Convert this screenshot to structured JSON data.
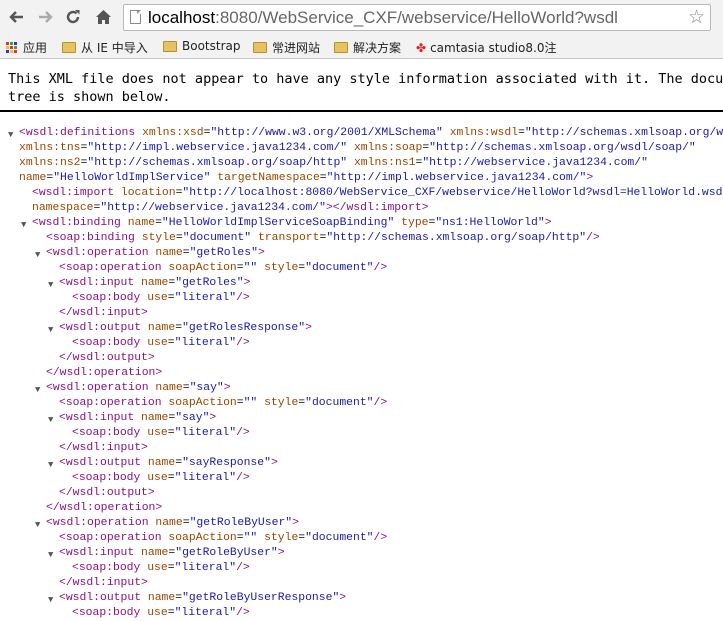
{
  "browser": {
    "url_host": "localhost",
    "url_rest": ":8080/WebService_CXF/webservice/HelloWorld?wsdl"
  },
  "bookmarks": [
    {
      "label": "应用",
      "icon": "apps-grid-icon"
    },
    {
      "label": "从 IE 中导入",
      "icon": "folder-icon"
    },
    {
      "label": "Bootstrap",
      "icon": "folder-icon"
    },
    {
      "label": "常进网站",
      "icon": "folder-icon"
    },
    {
      "label": "解决方案",
      "icon": "folder-icon"
    },
    {
      "label": "camtasia studio8.0注",
      "icon": "camtasia-icon"
    }
  ],
  "notice": {
    "line1": "This XML file does not appear to have any style information associated with it. The document",
    "line2": "tree is shown below."
  },
  "xml_lines": [
    {
      "collapse": true,
      "indent": 0,
      "tag": "<wsdl:definitions",
      "attrs": [
        [
          "xmlns:xsd",
          "http://www.w3.org/2001/XMLSchema"
        ],
        [
          "xmlns:wsdl",
          "http://schemas.xmlsoap.org/wsdl/"
        ]
      ],
      "end": ""
    },
    {
      "collapse": false,
      "indent": 0,
      "tag": "",
      "attrs": [
        [
          "xmlns:tns",
          "http://impl.webservice.java1234.com/"
        ],
        [
          "xmlns:soap",
          "http://schemas.xmlsoap.org/wsdl/soap/"
        ]
      ],
      "end": ""
    },
    {
      "collapse": false,
      "indent": 0,
      "tag": "",
      "attrs": [
        [
          "xmlns:ns2",
          "http://schemas.xmlsoap.org/soap/http"
        ],
        [
          "xmlns:ns1",
          "http://webservice.java1234.com/"
        ]
      ],
      "end": ""
    },
    {
      "collapse": false,
      "indent": 0,
      "tag": "",
      "attrs": [
        [
          "name",
          "HelloWorldImplService"
        ],
        [
          "targetNamespace",
          "http://impl.webservice.java1234.com/"
        ]
      ],
      "end": ">"
    },
    {
      "collapse": false,
      "indent": 1,
      "tag": "<wsdl:import",
      "attrs": [
        [
          "location",
          "http://localhost:8080/WebService_CXF/webservice/HelloWorld?wsdl=HelloWorld.wsdl"
        ]
      ],
      "end": ""
    },
    {
      "collapse": false,
      "indent": 1,
      "tag": "",
      "attrs": [
        [
          "namespace",
          "http://webservice.java1234.com/"
        ]
      ],
      "end": "></wsdl:import>"
    },
    {
      "collapse": true,
      "indent": 1,
      "tag": "<wsdl:binding",
      "attrs": [
        [
          "name",
          "HelloWorldImplServiceSoapBinding"
        ],
        [
          "type",
          "ns1:HelloWorld"
        ]
      ],
      "end": ">"
    },
    {
      "collapse": false,
      "indent": 2,
      "tag": "<soap:binding",
      "attrs": [
        [
          "style",
          "document"
        ],
        [
          "transport",
          "http://schemas.xmlsoap.org/soap/http"
        ]
      ],
      "end": "/>"
    },
    {
      "collapse": true,
      "indent": 2,
      "tag": "<wsdl:operation",
      "attrs": [
        [
          "name",
          "getRoles"
        ]
      ],
      "end": ">"
    },
    {
      "collapse": false,
      "indent": 3,
      "tag": "<soap:operation",
      "attrs": [
        [
          "soapAction",
          ""
        ],
        [
          "style",
          "document"
        ]
      ],
      "end": "/>"
    },
    {
      "collapse": true,
      "indent": 3,
      "tag": "<wsdl:input",
      "attrs": [
        [
          "name",
          "getRoles"
        ]
      ],
      "end": ">"
    },
    {
      "collapse": false,
      "indent": 4,
      "tag": "<soap:body",
      "attrs": [
        [
          "use",
          "literal"
        ]
      ],
      "end": "/>"
    },
    {
      "collapse": false,
      "indent": 3,
      "tag": "</wsdl:input>",
      "attrs": [],
      "end": ""
    },
    {
      "collapse": true,
      "indent": 3,
      "tag": "<wsdl:output",
      "attrs": [
        [
          "name",
          "getRolesResponse"
        ]
      ],
      "end": ">"
    },
    {
      "collapse": false,
      "indent": 4,
      "tag": "<soap:body",
      "attrs": [
        [
          "use",
          "literal"
        ]
      ],
      "end": "/>"
    },
    {
      "collapse": false,
      "indent": 3,
      "tag": "</wsdl:output>",
      "attrs": [],
      "end": ""
    },
    {
      "collapse": false,
      "indent": 2,
      "tag": "</wsdl:operation>",
      "attrs": [],
      "end": ""
    },
    {
      "collapse": true,
      "indent": 2,
      "tag": "<wsdl:operation",
      "attrs": [
        [
          "name",
          "say"
        ]
      ],
      "end": ">"
    },
    {
      "collapse": false,
      "indent": 3,
      "tag": "<soap:operation",
      "attrs": [
        [
          "soapAction",
          ""
        ],
        [
          "style",
          "document"
        ]
      ],
      "end": "/>"
    },
    {
      "collapse": true,
      "indent": 3,
      "tag": "<wsdl:input",
      "attrs": [
        [
          "name",
          "say"
        ]
      ],
      "end": ">"
    },
    {
      "collapse": false,
      "indent": 4,
      "tag": "<soap:body",
      "attrs": [
        [
          "use",
          "literal"
        ]
      ],
      "end": "/>"
    },
    {
      "collapse": false,
      "indent": 3,
      "tag": "</wsdl:input>",
      "attrs": [],
      "end": ""
    },
    {
      "collapse": true,
      "indent": 3,
      "tag": "<wsdl:output",
      "attrs": [
        [
          "name",
          "sayResponse"
        ]
      ],
      "end": ">"
    },
    {
      "collapse": false,
      "indent": 4,
      "tag": "<soap:body",
      "attrs": [
        [
          "use",
          "literal"
        ]
      ],
      "end": "/>"
    },
    {
      "collapse": false,
      "indent": 3,
      "tag": "</wsdl:output>",
      "attrs": [],
      "end": ""
    },
    {
      "collapse": false,
      "indent": 2,
      "tag": "</wsdl:operation>",
      "attrs": [],
      "end": ""
    },
    {
      "collapse": true,
      "indent": 2,
      "tag": "<wsdl:operation",
      "attrs": [
        [
          "name",
          "getRoleByUser"
        ]
      ],
      "end": ">"
    },
    {
      "collapse": false,
      "indent": 3,
      "tag": "<soap:operation",
      "attrs": [
        [
          "soapAction",
          ""
        ],
        [
          "style",
          "document"
        ]
      ],
      "end": "/>"
    },
    {
      "collapse": true,
      "indent": 3,
      "tag": "<wsdl:input",
      "attrs": [
        [
          "name",
          "getRoleByUser"
        ]
      ],
      "end": ">"
    },
    {
      "collapse": false,
      "indent": 4,
      "tag": "<soap:body",
      "attrs": [
        [
          "use",
          "literal"
        ]
      ],
      "end": "/>"
    },
    {
      "collapse": false,
      "indent": 3,
      "tag": "</wsdl:input>",
      "attrs": [],
      "end": ""
    },
    {
      "collapse": true,
      "indent": 3,
      "tag": "<wsdl:output",
      "attrs": [
        [
          "name",
          "getRoleByUserResponse"
        ]
      ],
      "end": ">"
    },
    {
      "collapse": false,
      "indent": 4,
      "tag": "<soap:body",
      "attrs": [
        [
          "use",
          "literal"
        ]
      ],
      "end": "/>"
    }
  ]
}
